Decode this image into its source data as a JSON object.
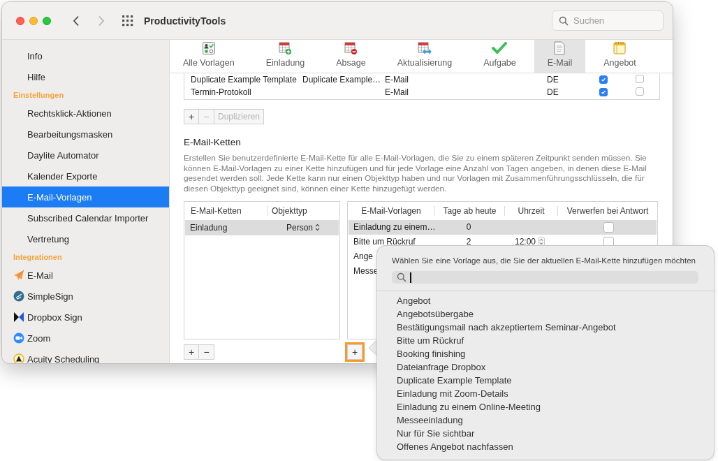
{
  "window": {
    "title": "ProductivityTools",
    "search": {
      "placeholder": "Suchen"
    }
  },
  "sidebar": {
    "items": [
      {
        "kind": "item",
        "label": "Info",
        "selected": false
      },
      {
        "kind": "item",
        "label": "Hilfe",
        "selected": false
      },
      {
        "kind": "header",
        "label": "Einstellungen"
      },
      {
        "kind": "item",
        "label": "Rechtsklick-Aktionen",
        "selected": false
      },
      {
        "kind": "item",
        "label": "Bearbeitungsmasken",
        "selected": false
      },
      {
        "kind": "item",
        "label": "Daylite Automator",
        "selected": false
      },
      {
        "kind": "item",
        "label": "Kalender Exporte",
        "selected": false
      },
      {
        "kind": "item",
        "label": "E-Mail-Vorlagen",
        "selected": true
      },
      {
        "kind": "item",
        "label": "Subscribed Calendar Importer",
        "selected": false
      },
      {
        "kind": "item",
        "label": "Vertretung",
        "selected": false
      },
      {
        "kind": "header",
        "label": "Integrationen"
      },
      {
        "kind": "integration",
        "label": "E-Mail",
        "selected": false
      },
      {
        "kind": "integration",
        "label": "SimpleSign",
        "selected": false
      },
      {
        "kind": "integration",
        "label": "Dropbox Sign",
        "selected": false
      },
      {
        "kind": "integration",
        "label": "Zoom",
        "selected": false
      },
      {
        "kind": "integration",
        "label": "Acuity Scheduling",
        "selected": false
      }
    ]
  },
  "toolbar": {
    "tabs": [
      {
        "label": "Alle Vorlagen",
        "selected": false
      },
      {
        "label": "Einladung",
        "selected": false
      },
      {
        "label": "Absage",
        "selected": false
      },
      {
        "label": "Aktualisierung",
        "selected": false
      },
      {
        "label": "Aufgabe",
        "selected": false
      },
      {
        "label": "E-Mail",
        "selected": true
      },
      {
        "label": "Angebot",
        "selected": false
      }
    ]
  },
  "templates_table": {
    "rows": [
      {
        "column_1": "Duplicate Example Template",
        "column_2": "Duplicate Example…",
        "column_3": "E-Mail",
        "column_4": "DE",
        "column_5_checked": true,
        "column_6_checked": false
      },
      {
        "column_1": "Termin-Protokoll",
        "column_3": "E-Mail",
        "column_4": "DE",
        "column_5_checked": true,
        "column_6_checked": false
      }
    ]
  },
  "template_buttons": [
    {
      "label": "+",
      "disabled": false
    },
    {
      "label": "−",
      "disabled": true
    },
    {
      "label": "Duplizieren",
      "disabled": true
    }
  ],
  "chains": {
    "title": "E-Mail-Ketten",
    "description": "Erstellen Sie benutzerdefinierte E-Mail-Kette für alle E-Mail-Vorlagen, die Sie zu einem späteren Zeitpunkt senden müssen. Sie können E-Mail-Vorlagen zu einer Kette hinzufügen und für jede Vorlage eine Anzahl von Tagen angeben, in denen diese E-Mail gesendet werden soll. Jede Kette kann nur einen Objekttyp haben und nur Vorlagen mit Zusammenführungsschlüsseln, die für diesen Objekttyp geeignet sind, können einer Kette hinzugefügt werden.",
    "chains_table": {
      "columns": [
        "E-Mail-Ketten",
        "Objekttyp"
      ],
      "rows": [
        {
          "name": "Einladung",
          "object_type": "Person",
          "selected": true
        }
      ],
      "buttons": [
        {
          "label": "+",
          "disabled": false
        },
        {
          "label": "−",
          "disabled": false
        }
      ]
    },
    "templates_table": {
      "columns": [
        "E-Mail-Vorlagen",
        "Tage ab heute",
        "Uhrzeit",
        "Verwerfen bei Antwort"
      ],
      "rows": [
        {
          "name": "Einladung zu einem…",
          "days": "0",
          "discard_on_reply": false,
          "selected": true
        },
        {
          "name": "Bitte um Rückruf",
          "days": "2",
          "time": "12:00",
          "discard_on_reply": false,
          "selected": false
        },
        {
          "name": "Ange",
          "selected": false
        },
        {
          "name": "Messe",
          "selected": false
        }
      ],
      "add_button": {
        "label": "+",
        "highlighted": true
      }
    }
  },
  "popover": {
    "prompt": "Wählen Sie eine Vorlage aus, die Sie der aktuellen E-Mail-Kette hinzufügen möchten",
    "items": [
      {
        "label": "Angebot",
        "selected": false
      },
      {
        "label": "Angebotsübergabe",
        "selected": false
      },
      {
        "label": "Bestätigungsmail nach akzeptiertem Seminar-Angebot",
        "selected": false
      },
      {
        "label": "Bitte um Rückruf",
        "selected": false
      },
      {
        "label": "Booking finishing",
        "selected": false
      },
      {
        "label": "Dateianfrage Dropbox",
        "selected": false
      },
      {
        "label": "Duplicate Example Template",
        "selected": false
      },
      {
        "label": "Einladung mit Zoom-Details",
        "selected": false
      },
      {
        "label": "Einladung zu einem Online-Meeting",
        "selected": false
      },
      {
        "label": "Messeeinladung",
        "selected": false
      },
      {
        "label": "Nur für Sie sichtbar",
        "selected": false
      },
      {
        "label": "Offenes Angebot nachfassen",
        "selected": false
      }
    ]
  }
}
